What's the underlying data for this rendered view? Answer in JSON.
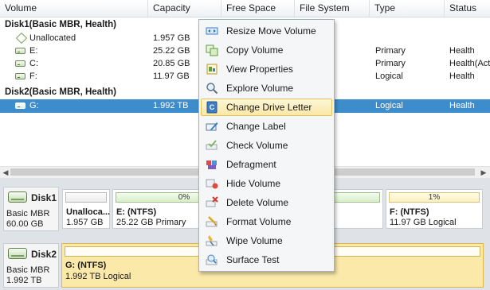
{
  "columns": [
    "Volume",
    "Capacity",
    "Free Space",
    "File System",
    "Type",
    "Status"
  ],
  "disk1": {
    "header": "Disk1(Basic MBR, Health)",
    "rows": [
      {
        "volume": "Unallocated",
        "capacity": "1.957 GB",
        "type": "",
        "status": ""
      },
      {
        "volume": "E:",
        "capacity": "25.22 GB",
        "type": "Primary",
        "status": "Health"
      },
      {
        "volume": "C:",
        "capacity": "20.85 GB",
        "type": "Primary",
        "status": "Health(Acti"
      },
      {
        "volume": "F:",
        "capacity": "11.97 GB",
        "type": "Logical",
        "status": "Health"
      }
    ]
  },
  "disk2": {
    "header": "Disk2(Basic MBR, Health)",
    "rows": [
      {
        "volume": "G:",
        "capacity": "1.992 TB",
        "type": "Logical",
        "status": "Health"
      }
    ]
  },
  "diskmap": {
    "disk1": {
      "name": "Disk1",
      "kind": "Basic MBR",
      "size": "60.00 GB",
      "partitions": [
        {
          "title": "Unalloca...",
          "sub": "1.957 GB",
          "bar": ""
        },
        {
          "title": "E: (NTFS)",
          "sub": "25.22 GB Primary",
          "bar": "0%"
        },
        {
          "title": "F: (NTFS)",
          "sub": "11.97 GB Logical",
          "bar": "1%"
        }
      ]
    },
    "disk2": {
      "name": "Disk2",
      "kind": "Basic MBR",
      "size": "1.992 TB",
      "partitions": [
        {
          "title": "G: (NTFS)",
          "sub": "1.992 TB Logical",
          "bar": ""
        }
      ]
    }
  },
  "menu": {
    "items": [
      {
        "label": "Resize Move Volume",
        "icon": "resize-icon"
      },
      {
        "label": "Copy Volume",
        "icon": "copy-icon"
      },
      {
        "label": "View Properties",
        "icon": "properties-icon"
      },
      {
        "label": "Explore Volume",
        "icon": "explore-icon"
      },
      {
        "label": "Change Drive Letter",
        "icon": "drive-letter-icon"
      },
      {
        "label": "Change Label",
        "icon": "label-icon"
      },
      {
        "label": "Check Volume",
        "icon": "check-icon"
      },
      {
        "label": "Defragment",
        "icon": "defragment-icon"
      },
      {
        "label": "Hide Volume",
        "icon": "hide-icon"
      },
      {
        "label": "Delete Volume",
        "icon": "delete-icon"
      },
      {
        "label": "Format Volume",
        "icon": "format-icon"
      },
      {
        "label": "Wipe Volume",
        "icon": "wipe-icon"
      },
      {
        "label": "Surface Test",
        "icon": "surface-test-icon"
      }
    ],
    "highlighted_index": 4
  },
  "colors": {
    "selection": "#3d8ccb",
    "menu_highlight": "#fbe9a6",
    "selected_partition": "#fbe9a9"
  }
}
